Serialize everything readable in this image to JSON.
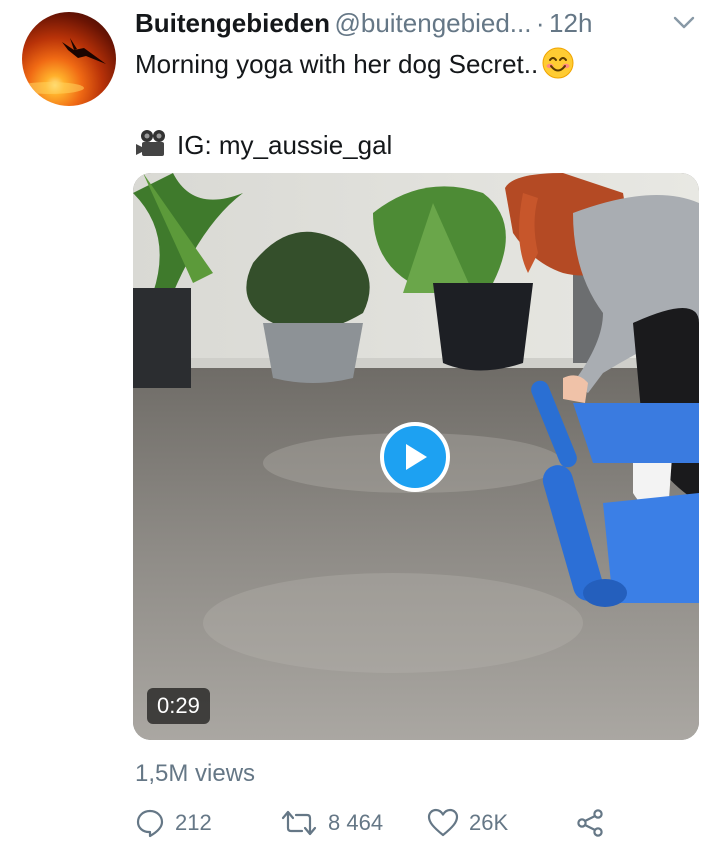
{
  "tweet": {
    "author_name": "Buitengebieden",
    "author_handle": "@buitengebied...",
    "separator": "·",
    "time": "12h",
    "text_line1": "Morning yoga with her dog Secret..",
    "text_line2": "IG: my_aussie_gal",
    "emoji_name": "smiling-face-with-smiling-eyes",
    "camera_icon": "movie-camera"
  },
  "media": {
    "duration": "0:29",
    "play_color": "#1da1f2"
  },
  "stats": {
    "views": "1,5M views"
  },
  "actions": {
    "reply_count": "212",
    "retweet_count": "8 464",
    "like_count": "26K"
  },
  "colors": {
    "text": "#14171a",
    "secondary": "#657786",
    "accent": "#1da1f2"
  }
}
